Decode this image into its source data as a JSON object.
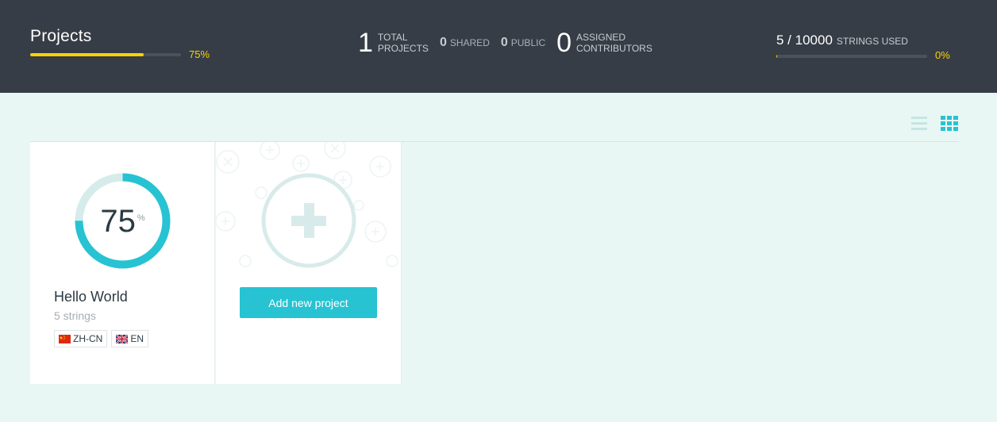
{
  "header": {
    "title": "Projects",
    "progress_percent_label": "75%",
    "progress_fraction": 0.75,
    "stats": {
      "total_projects": {
        "value": "1",
        "label_line1": "TOTAL",
        "label_line2": "PROJECTS"
      },
      "shared": {
        "value": "0",
        "label": "SHARED"
      },
      "public": {
        "value": "0",
        "label": "PUBLIC"
      },
      "assigned_contributors": {
        "value": "0",
        "label_line1": "ASSIGNED",
        "label_line2": "CONTRIBUTORS"
      }
    },
    "strings_used": {
      "value": "5 / 10000",
      "label": "STRINGS USED",
      "percent_label": "0%",
      "fraction": 0.0005
    }
  },
  "view_toggle": {
    "list_icon": "list-icon",
    "grid_icon": "grid-icon",
    "active": "grid"
  },
  "projects": [
    {
      "completion_value": "75",
      "completion_unit": "%",
      "completion_fraction": 0.75,
      "name": "Hello World",
      "strings": "5 strings",
      "languages": [
        {
          "code": "ZH-CN",
          "flag_icon": "china-flag-icon"
        },
        {
          "code": "EN",
          "flag_icon": "uk-flag-icon"
        }
      ]
    }
  ],
  "add_project": {
    "button_label": "Add new project",
    "icon": "plus-icon"
  },
  "colors": {
    "header_bg": "#363d46",
    "accent_yellow": "#ffd200",
    "accent_teal": "#27c3d2",
    "page_bg": "#e8f7f4"
  }
}
